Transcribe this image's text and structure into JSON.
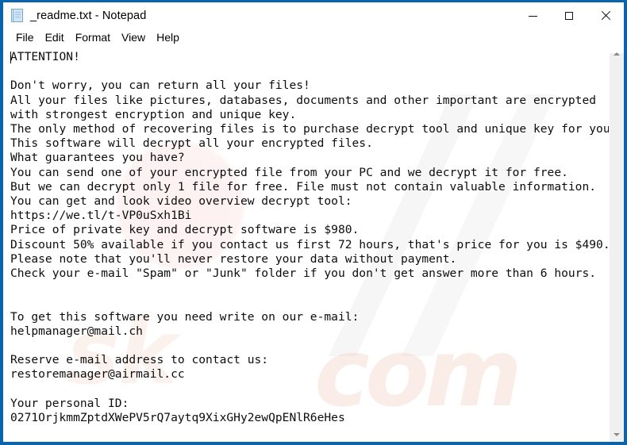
{
  "window": {
    "title": "_readme.txt - Notepad",
    "icon": "notepad-icon",
    "border_color": "#0a64ad",
    "background": "#ffffff"
  },
  "controls": {
    "minimize_label": "—",
    "maximize_label": "□",
    "close_label": "✕"
  },
  "menu": {
    "items": [
      {
        "label": "File"
      },
      {
        "label": "Edit"
      },
      {
        "label": "Format"
      },
      {
        "label": "View"
      },
      {
        "label": "Help"
      }
    ]
  },
  "document": {
    "file_name": "_readme.txt",
    "text": "ATTENTION!\n\nDon't worry, you can return all your files!\nAll your files like pictures, databases, documents and other important are encrypted\nwith strongest encryption and unique key.\nThe only method of recovering files is to purchase decrypt tool and unique key for you.\nThis software will decrypt all your encrypted files.\nWhat guarantees you have?\nYou can send one of your encrypted file from your PC and we decrypt it for free.\nBut we can decrypt only 1 file for free. File must not contain valuable information.\nYou can get and look video overview decrypt tool:\nhttps://we.tl/t-VP0uSxh1Bi\nPrice of private key and decrypt software is $980.\nDiscount 50% available if you contact us first 72 hours, that's price for you is $490.\nPlease note that you'll never restore your data without payment.\nCheck your e-mail \"Spam\" or \"Junk\" folder if you don't get answer more than 6 hours.\n\n\nTo get this software you need write on our e-mail:\nhelpmanager@mail.ch\n\nReserve e-mail address to contact us:\nrestoremanager@airmail.cc\n\nYour personal ID:\n0271OrjkmmZptdXWePV5rQ7aytq9XixGHy2ewQpENlR6eHes",
    "video_url": "https://we.tl/t-VP0uSxh1Bi",
    "price_full": "$980",
    "price_discount": "$490",
    "discount_percent": "50%",
    "discount_window_hours": "72 hours",
    "response_time": "6 hours",
    "email_primary": "helpmanager@mail.ch",
    "email_reserve": "restoremanager@airmail.cc",
    "personal_id": "0271OrjkmmZptdXWePV5rQ7aytq9XixGHy2ewQpENlR6eHes"
  },
  "scrollbar": {
    "up_arrow": "scroll-up-arrow",
    "down_arrow": "scroll-down-arrow"
  },
  "watermark": {
    "dotcom_text": "com",
    "sk_text": "sk",
    "color": "#eec4b4"
  }
}
